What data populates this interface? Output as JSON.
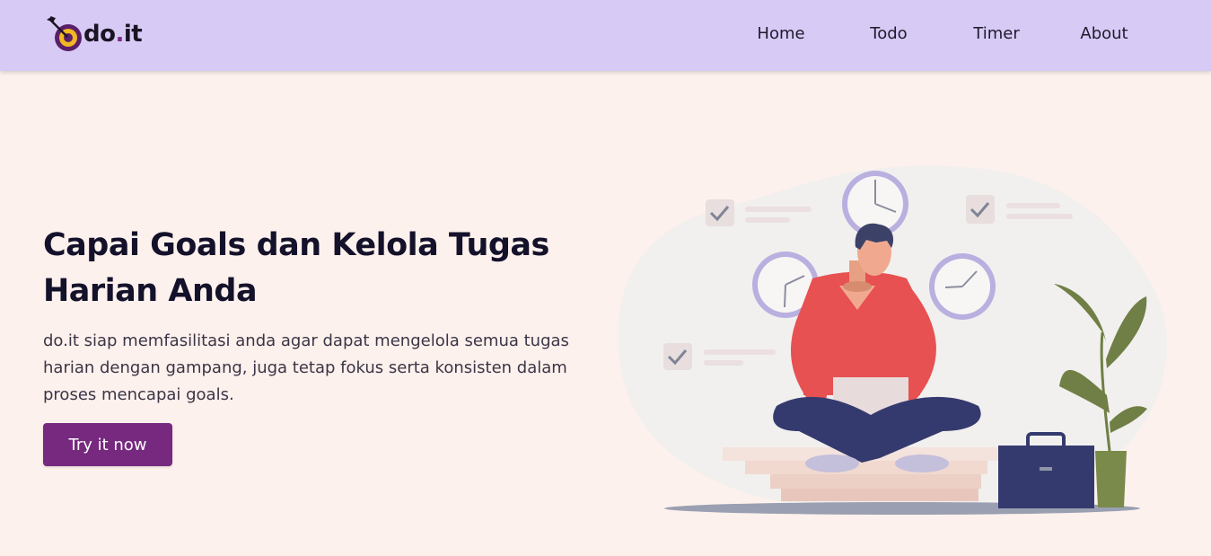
{
  "brand": {
    "name_main": "do",
    "name_dot": ".",
    "name_tail": "it",
    "logo_icon": "target-arrow-icon"
  },
  "nav": {
    "items": [
      {
        "label": "Home"
      },
      {
        "label": "Todo"
      },
      {
        "label": "Timer"
      },
      {
        "label": "About"
      }
    ]
  },
  "hero": {
    "title": "Capai Goals dan Kelola Tugas Harian Anda",
    "description": "do.it siap memfasilitasi anda agar dapat mengelola semua tugas harian dengan gampang, juga tetap fokus serta konsisten dalam proses mencapai goals.",
    "cta_label": "Try it now"
  },
  "colors": {
    "navbar_bg": "#d7cbf6",
    "page_bg": "#fdf1ed",
    "accent": "#76297e",
    "text_dark": "#14112a"
  }
}
